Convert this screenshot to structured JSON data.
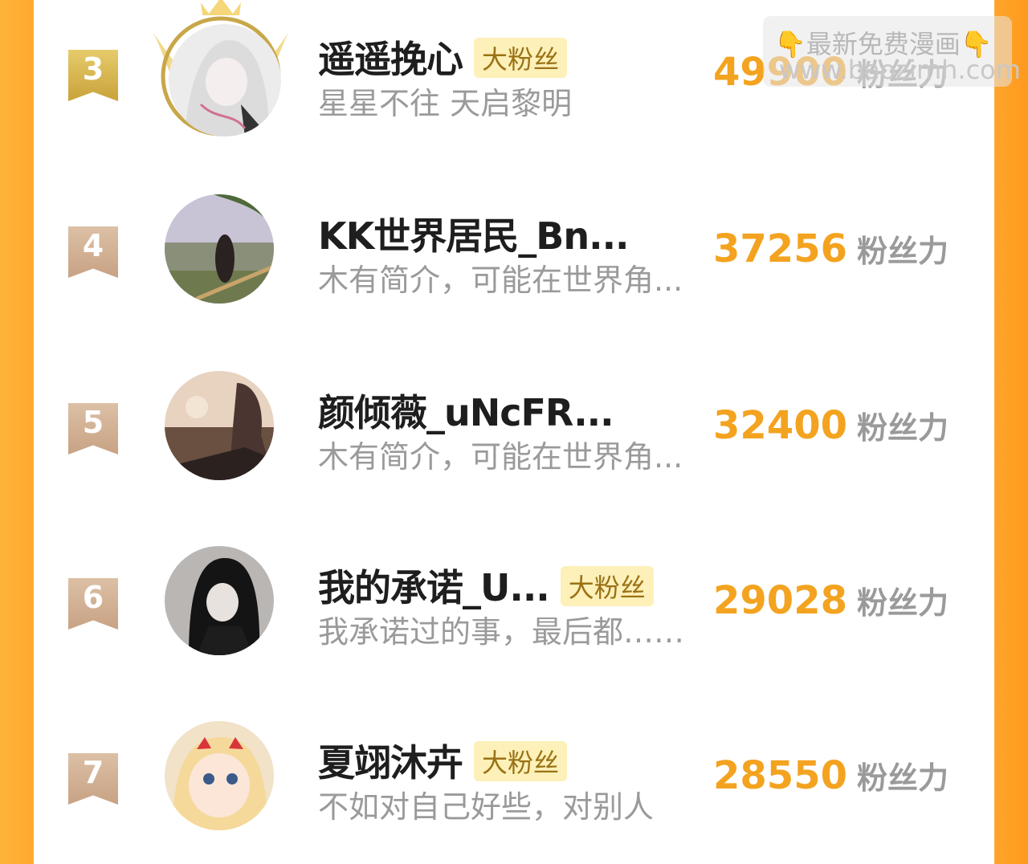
{
  "watermark": {
    "line1": "最新免费漫画",
    "line2": "www.baozimh.com",
    "hand_glyph": "👇"
  },
  "units": {
    "fan_power": "粉丝力"
  },
  "colors": {
    "accent": "#f3a31f",
    "gold": "#c9a23a",
    "bronze": "#c8a284",
    "badge_bg": "#fdf0b8"
  },
  "leaderboard": [
    {
      "rank": "3",
      "name": "遥遥挽心",
      "badge": "大粉丝",
      "bio": "星星不往 天启黎明",
      "score": "49900",
      "tier": "gold",
      "crowned": true
    },
    {
      "rank": "4",
      "name": "KK世界居民_Bn...",
      "badge": "",
      "bio": "木有简介，可能在世界角...",
      "score": "37256",
      "tier": "bronze",
      "crowned": false
    },
    {
      "rank": "5",
      "name": "颜倾薇_uNcFR...",
      "badge": "",
      "bio": "木有简介，可能在世界角...",
      "score": "32400",
      "tier": "bronze",
      "crowned": false
    },
    {
      "rank": "6",
      "name": "我的承诺_U...",
      "badge": "大粉丝",
      "bio": "我承诺过的事，最后都……",
      "score": "29028",
      "tier": "bronze",
      "crowned": false
    },
    {
      "rank": "7",
      "name": "夏翊沐卉",
      "badge": "大粉丝",
      "bio": "不如对自己好些，对别人",
      "score": "28550",
      "tier": "bronze",
      "crowned": false
    }
  ]
}
